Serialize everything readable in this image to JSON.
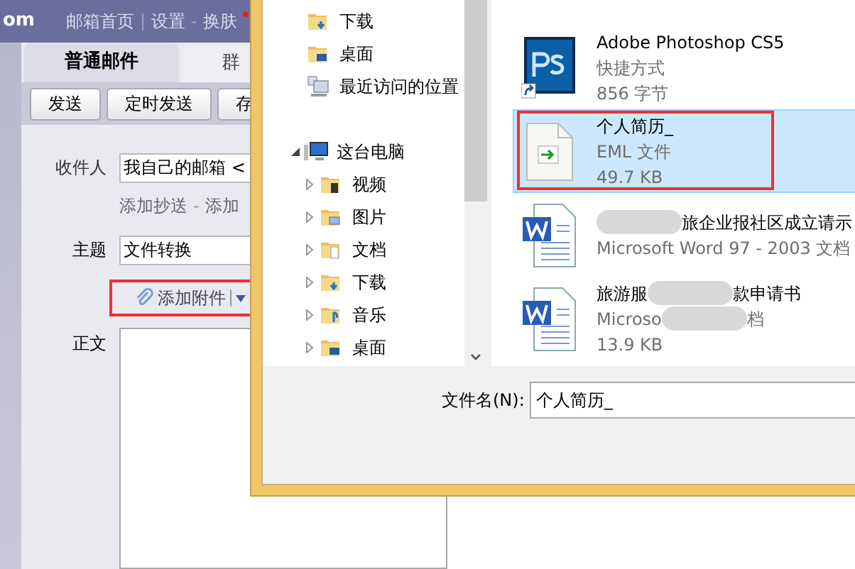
{
  "email": {
    "header_left": "om",
    "header_items": [
      {
        "text": "邮箱首页",
        "kind": "link"
      },
      {
        "text": "|",
        "kind": "sep"
      },
      {
        "text": "设置",
        "kind": "link"
      },
      {
        "text": "-",
        "kind": "sep"
      },
      {
        "text": "换肤",
        "kind": "link"
      }
    ],
    "has_notification": true,
    "tabs": [
      {
        "label": "普通邮件",
        "selected": true
      },
      {
        "label": "群",
        "selected": false
      }
    ],
    "toolbar_buttons": [
      "发送",
      "定时发送",
      "存"
    ],
    "to_label": "收件人",
    "to_value": "我自己的邮箱 <",
    "cc_links": [
      {
        "text": "添加抄送",
        "kind": "link"
      },
      {
        "text": "-",
        "kind": "sep"
      },
      {
        "text": "添加",
        "kind": "link"
      }
    ],
    "subject_label": "主题",
    "subject_value": "文件转换",
    "attach_label": "添加附件",
    "attach_highlighted": true,
    "body_label": "正文"
  },
  "dialog": {
    "nav": [
      {
        "label": "下载",
        "kind": "downloads"
      },
      {
        "label": "桌面",
        "kind": "desktop"
      },
      {
        "label": "最近访问的位置",
        "kind": "recent"
      }
    ],
    "computer": {
      "label": "这台电脑",
      "expanded": true,
      "children": [
        {
          "label": "视频",
          "kind": "videos",
          "expanded": false
        },
        {
          "label": "图片",
          "kind": "pictures",
          "expanded": false
        },
        {
          "label": "文档",
          "kind": "documents",
          "expanded": false
        },
        {
          "label": "下载",
          "kind": "downloads",
          "expanded": false
        },
        {
          "label": "音乐",
          "kind": "music",
          "expanded": false
        },
        {
          "label": "桌面",
          "kind": "desktop",
          "expanded": false
        }
      ]
    },
    "files": [
      {
        "kind": "shortcut",
        "name": [
          {
            "kind": "text",
            "text": "Adobe Photoshop CS5"
          }
        ],
        "type": [
          {
            "kind": "text",
            "text": "快捷方式"
          }
        ],
        "size": "856 字节",
        "selected": false,
        "highlighted": false
      },
      {
        "kind": "eml",
        "name": [
          {
            "kind": "text",
            "text": "个人简历_"
          }
        ],
        "type": [
          {
            "kind": "text",
            "text": "EML 文件"
          }
        ],
        "size": "49.7 KB",
        "selected": true,
        "highlighted": true
      },
      {
        "kind": "word",
        "name": [
          {
            "kind": "blur"
          },
          {
            "kind": "text",
            "text": "旅企业报社区成立请示"
          }
        ],
        "type": [
          {
            "kind": "text",
            "text": "Microsoft Word 97 - 2003 文档"
          }
        ],
        "selected": false,
        "highlighted": false
      },
      {
        "kind": "word",
        "name": [
          {
            "kind": "text",
            "text": "旅游服"
          },
          {
            "kind": "blur"
          },
          {
            "kind": "text",
            "text": "款申请书"
          }
        ],
        "type": [
          {
            "kind": "text",
            "text": "Microso"
          },
          {
            "kind": "blur"
          },
          {
            "kind": "text",
            "text": "档"
          }
        ],
        "size": "13.9 KB",
        "selected": false,
        "highlighted": false
      }
    ],
    "filename_label": "文件名(N):",
    "filename_value": "个人简历_"
  }
}
